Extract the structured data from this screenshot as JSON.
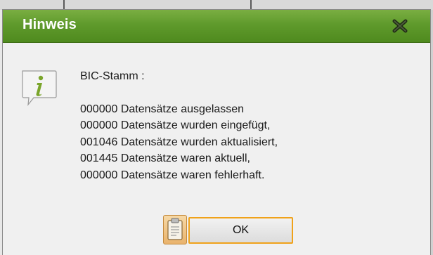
{
  "dialog": {
    "title": "Hinweis",
    "close_icon": "close-icon",
    "info_icon": "info-icon",
    "message": {
      "heading": "BIC-Stamm :",
      "lines": [
        "000000 Datensätze ausgelassen",
        "000000 Datensätze wurden eingefügt,",
        "001046 Datensätze wurden aktualisiert,",
        "001445 Datensätze waren aktuell,",
        "000000 Datensätze waren fehlerhaft."
      ]
    },
    "buttons": {
      "clipboard_icon": "clipboard-icon",
      "ok_label": "OK"
    }
  },
  "colors": {
    "titlebar": "#5f9a2c",
    "ok_border": "#f0a21a",
    "info_icon": "#7aa52b"
  }
}
